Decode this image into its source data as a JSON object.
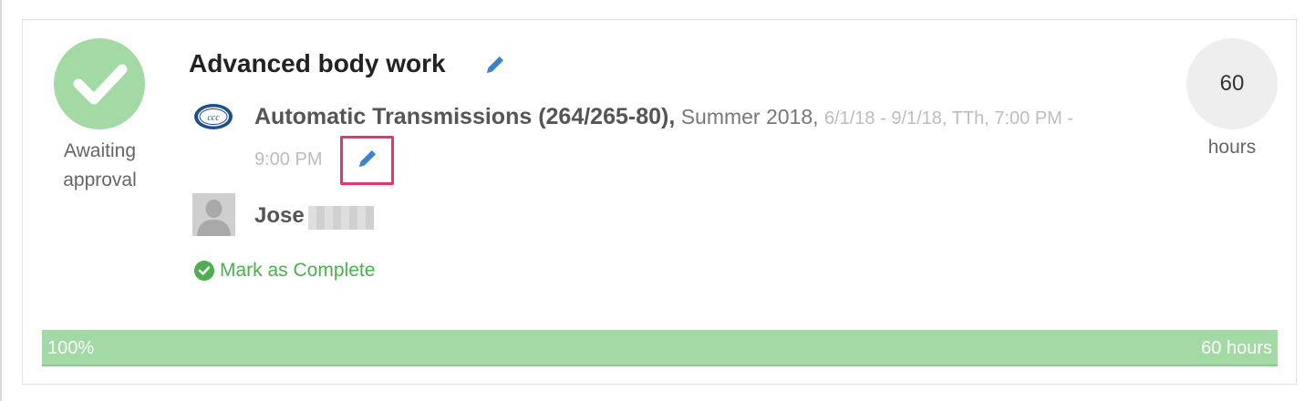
{
  "status": {
    "label_line1": "Awaiting",
    "label_line2": "approval",
    "icon": "checkmark-icon",
    "color": "#a3d9a5"
  },
  "course": {
    "title": "Advanced body work",
    "name": "Automatic Transmissions (264/265-80),",
    "term": "Summer 2018,",
    "schedule_part1": "6/1/18 - 9/1/18, TTh, 7:00 PM -",
    "schedule_part2": "9:00 PM",
    "org_logo": "ccc",
    "edit_icon": "pencil-icon"
  },
  "student": {
    "first_name": "Jose"
  },
  "actions": {
    "mark_complete": "Mark as Complete"
  },
  "hours": {
    "value": "60",
    "label": "hours"
  },
  "progress": {
    "fraction": 1.0,
    "percent_label": "100%",
    "total_label": "60 hours",
    "color": "#a3d9a5"
  },
  "colors": {
    "accent_green": "#4caf50",
    "edit_blue": "#3b83c4",
    "highlight": "#e8336d"
  }
}
